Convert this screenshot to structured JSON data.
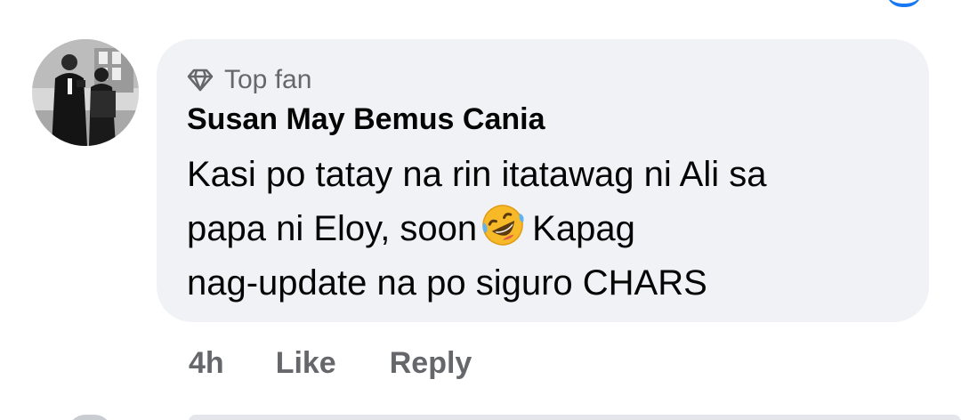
{
  "comment": {
    "badge": {
      "icon": "diamond-icon",
      "label": "Top fan"
    },
    "author": "Susan May Bemus Cania",
    "text_lines": [
      "Kasi po tatay na rin itatawag ni Ali sa",
      "papa ni Eloy, soon",
      "Kapag",
      "nag-update na po siguro CHARS"
    ],
    "emoji": "rolling-on-floor-laughing-emoji",
    "time": "4h",
    "actions": {
      "like_label": "Like",
      "reply_label": "Reply"
    }
  },
  "colors": {
    "bubble_bg": "#f0f2f5",
    "secondary_text": "#65676b",
    "primary_text": "#050505",
    "accent": "#1877f2"
  }
}
